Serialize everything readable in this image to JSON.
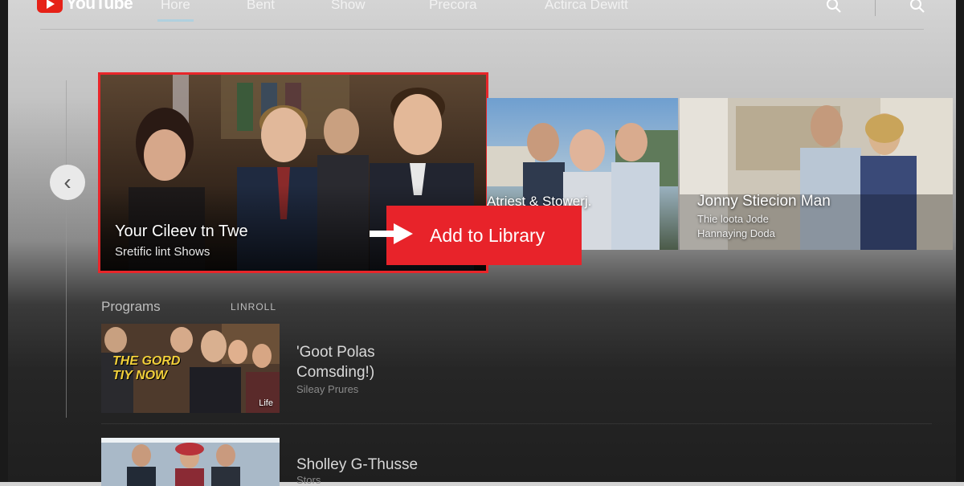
{
  "app": {
    "logo_text": "YouTube"
  },
  "nav": {
    "tabs": [
      {
        "label": "Hore"
      },
      {
        "label": "Bent"
      },
      {
        "label": "Show"
      },
      {
        "label": "Precora"
      },
      {
        "label": "Actirca Dewitt"
      }
    ],
    "icons": [
      "search-icon",
      "search-icon"
    ]
  },
  "hero": {
    "featured": {
      "title": "Your Cileev tn Twe",
      "subtitle": "Sretific lint Shows"
    },
    "card2": {
      "title": "Atriest & Stowerj."
    },
    "card3": {
      "title": "Jonny Stiecion Man",
      "line1": "Thie loota Jode",
      "line2": "Hannaying Doda"
    },
    "add_to_library": "Add to Library"
  },
  "programs": {
    "heading": "Programs",
    "subheading": "LINROLL",
    "items": [
      {
        "title_line1": "'Goot Polas",
        "title_line2": "Comsding!)",
        "meta": "Sileay Prures",
        "thumb_text": "THE GORD TIY NOW",
        "thumb_badge": "Life"
      },
      {
        "title_line1": "Sholley G-Thusse",
        "title_line2": "",
        "meta": "Stors",
        "thumb_text": "",
        "thumb_badge": ""
      }
    ]
  },
  "colors": {
    "accent": "#e8232a",
    "logo_red": "#e62117"
  }
}
